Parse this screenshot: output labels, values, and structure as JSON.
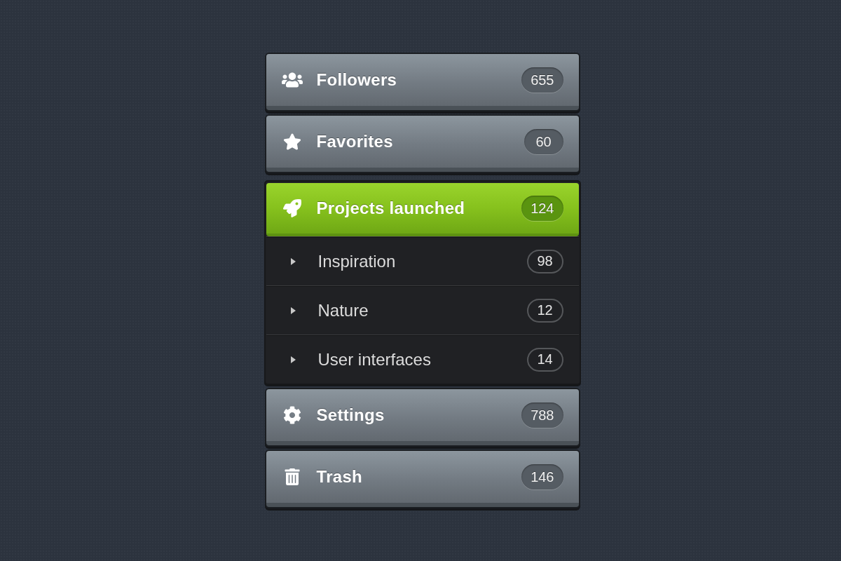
{
  "menu": {
    "items": [
      {
        "label": "Followers",
        "count": "655",
        "selected": false
      },
      {
        "label": "Favorites",
        "count": "60",
        "selected": false
      },
      {
        "label": "Projects launched",
        "count": "124",
        "selected": true,
        "children": [
          {
            "label": "Inspiration",
            "count": "98"
          },
          {
            "label": "Nature",
            "count": "12"
          },
          {
            "label": "User interfaces",
            "count": "14"
          }
        ]
      },
      {
        "label": "Settings",
        "count": "788",
        "selected": false
      },
      {
        "label": "Trash",
        "count": "146",
        "selected": false
      }
    ]
  }
}
